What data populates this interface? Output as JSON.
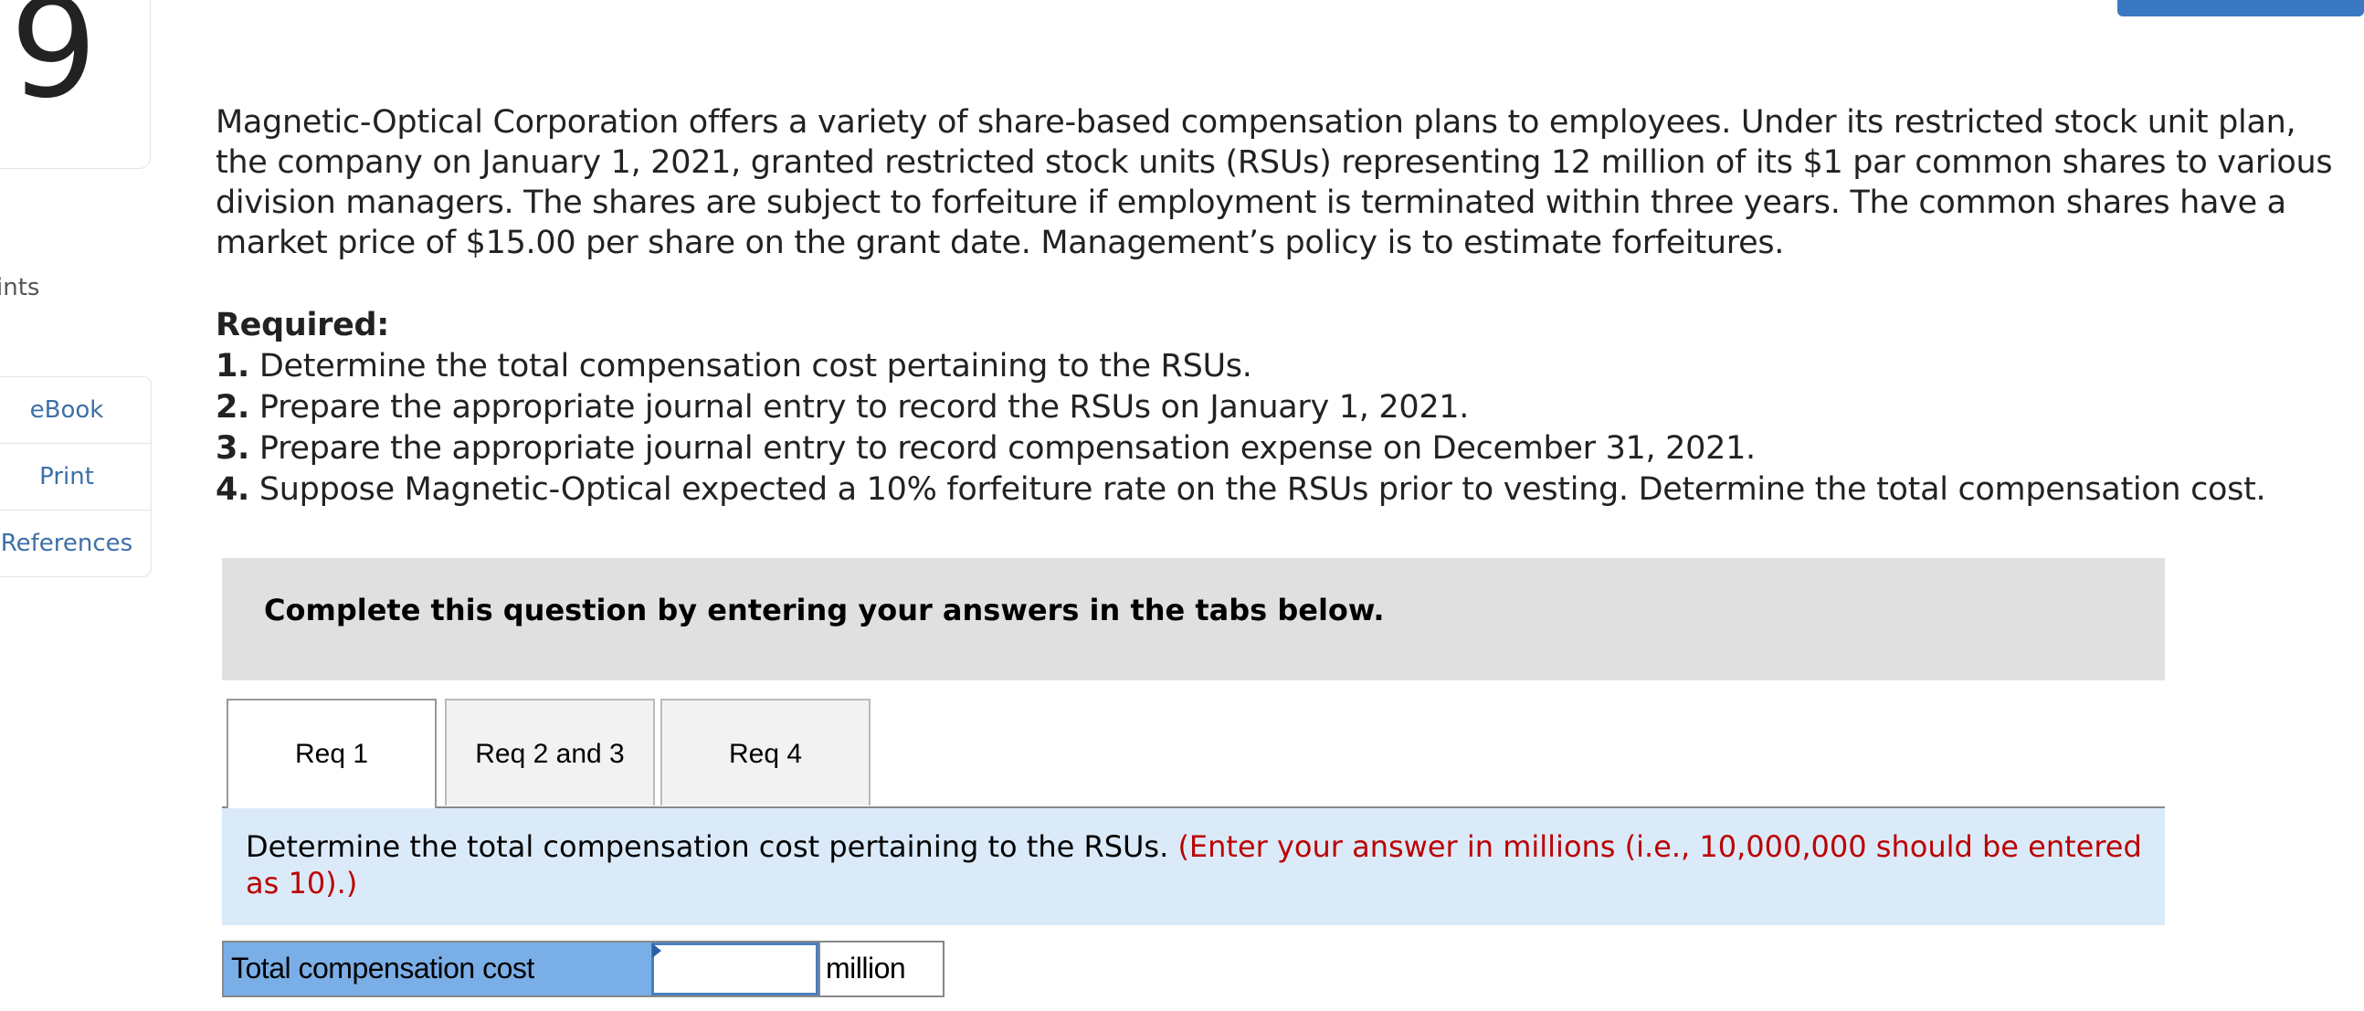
{
  "question_number": "9",
  "points_label": "ints",
  "sidebar": {
    "items": [
      {
        "label": "eBook"
      },
      {
        "label": "Print"
      },
      {
        "label": "References"
      }
    ]
  },
  "problem": {
    "lines": [
      "Magnetic-Optical Corporation offers a variety of share-based compensation plans to employees. Under its restricted stock unit plan,",
      "the company on January 1, 2021, granted restricted stock units (RSUs) representing 12 million of its $1 par common shares to various",
      "division managers. The shares are subject to forfeiture if employment is terminated within three years. The common shares have a",
      "market price of $15.00 per share on the grant date. Management’s policy is to estimate forfeitures."
    ]
  },
  "required": {
    "heading": "Required:",
    "items": [
      {
        "num": "1.",
        "text": " Determine the total compensation cost pertaining to the RSUs."
      },
      {
        "num": "2.",
        "text": " Prepare the appropriate journal entry to record the RSUs on January 1, 2021."
      },
      {
        "num": "3.",
        "text": " Prepare the appropriate journal entry to record compensation expense on December 31, 2021."
      },
      {
        "num": "4.",
        "text": " Suppose Magnetic-Optical expected a 10% forfeiture rate on the RSUs prior to vesting. Determine the total compensation cost."
      }
    ]
  },
  "instruction": "Complete this question by entering your answers in the tabs below.",
  "tabs": [
    {
      "label": "Req 1",
      "active": true
    },
    {
      "label": "Req 2 and 3"
    },
    {
      "label": "Req 4"
    }
  ],
  "req1": {
    "prompt": "Determine the total compensation cost pertaining to the RSUs.",
    "note": "(Enter your answer in millions (i.e., 10,000,000 should be entered as 10).)",
    "row_label": "Total compensation cost",
    "value": "",
    "unit": "million"
  },
  "colors": {
    "accent": "#3b78c3",
    "label_bg": "#7aaee6",
    "band_bg": "#dbeaf8",
    "note": "#b00000"
  }
}
